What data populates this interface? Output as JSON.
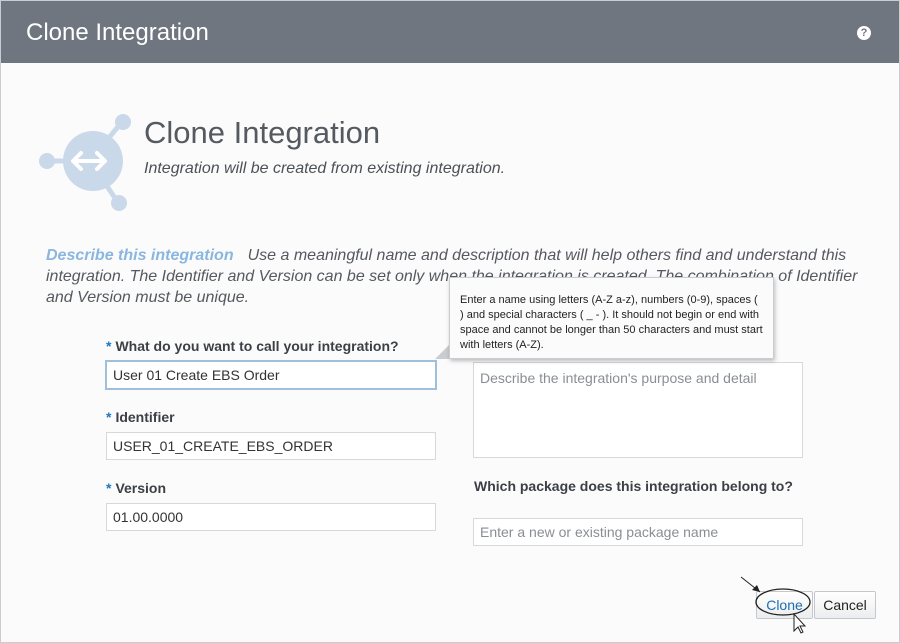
{
  "window": {
    "title": "Clone Integration",
    "help_glyph": "?"
  },
  "hero": {
    "title": "Clone Integration",
    "subtitle": "Integration will be created from existing integration."
  },
  "describe": {
    "lead": "Describe this integration",
    "text": "Use a meaningful name and description that will help others find and understand this integration. The Identifier and Version can be set only when the integration is created. The combination of Identifier and Version must be unique."
  },
  "fields": {
    "required_marker": "*",
    "name": {
      "label": "What do you want to call your integration?",
      "value": "User 01 Create EBS Order"
    },
    "identifier": {
      "label": "Identifier",
      "value": "USER_01_CREATE_EBS_ORDER"
    },
    "version": {
      "label": "Version",
      "value": "01.00.0000"
    },
    "description": {
      "placeholder": "Describe the integration's purpose and detail"
    },
    "package": {
      "label": "Which package does this integration belong to?",
      "placeholder": "Enter a new or existing package name"
    }
  },
  "tooltip": {
    "text": "Enter a name using letters (A-Z a-z), numbers (0-9), spaces ( ) and special characters ( _ - ). It should not begin or end with space and cannot be longer than 50 characters and must start with letters (A-Z)."
  },
  "buttons": {
    "clone": "Clone",
    "cancel": "Cancel"
  },
  "colors": {
    "titlebar": "#6f7680",
    "accent": "#1d77c0",
    "lead_text": "#8ab6e0",
    "icon": "#c9d9ea"
  }
}
